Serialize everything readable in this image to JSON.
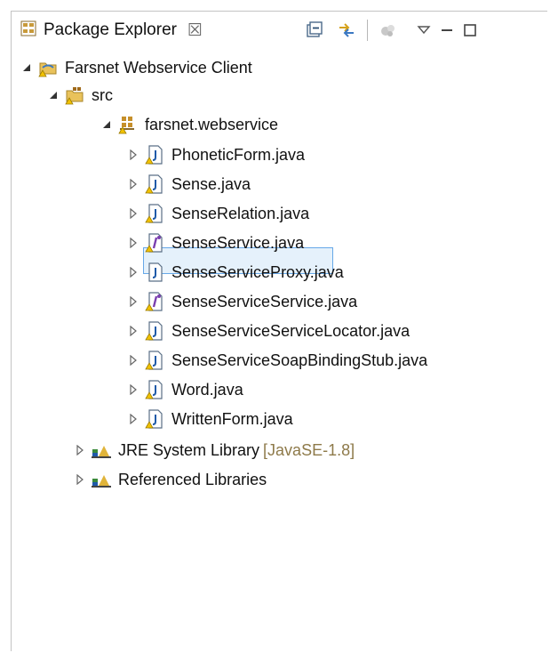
{
  "panel": {
    "title": "Package Explorer",
    "close_glyph": "☒",
    "title_icon": "package-explorer-icon",
    "tools": [
      "collapse-all-icon",
      "link-with-editor-icon",
      "focus-on-active-task-icon",
      "view-menu-icon",
      "minimize-icon",
      "maximize-icon"
    ]
  },
  "tree": {
    "project": {
      "label": "Farsnet Webservice Client",
      "icon": "java-project-warning-icon",
      "expanded": true
    },
    "src_folder": {
      "label": "src",
      "icon": "source-folder-warning-icon",
      "expanded": true
    },
    "package": {
      "label": "farsnet.webservice",
      "icon": "package-warning-icon",
      "expanded": true
    },
    "files": [
      {
        "label": "PhoneticForm.java",
        "icon": "java-class-warning-icon",
        "selected": false
      },
      {
        "label": "Sense.java",
        "icon": "java-class-warning-icon",
        "selected": false
      },
      {
        "label": "SenseRelation.java",
        "icon": "java-class-warning-icon",
        "selected": false
      },
      {
        "label": "SenseService.java",
        "icon": "java-interface-warning-icon",
        "selected": true
      },
      {
        "label": "SenseServiceProxy.java",
        "icon": "java-class-icon",
        "selected": false
      },
      {
        "label": "SenseServiceService.java",
        "icon": "java-interface-warning-icon",
        "selected": false
      },
      {
        "label": "SenseServiceServiceLocator.java",
        "icon": "java-class-warning-icon",
        "selected": false
      },
      {
        "label": "SenseServiceSoapBindingStub.java",
        "icon": "java-class-warning-icon",
        "selected": false
      },
      {
        "label": "Word.java",
        "icon": "java-class-warning-icon",
        "selected": false
      },
      {
        "label": "WrittenForm.java",
        "icon": "java-class-warning-icon",
        "selected": false
      }
    ],
    "libraries": [
      {
        "label": "JRE System Library",
        "decoration": "[JavaSE-1.8]",
        "icon": "library-icon"
      },
      {
        "label": "Referenced Libraries",
        "decoration": "",
        "icon": "library-icon"
      }
    ]
  },
  "colors": {
    "selection_border": "#67a8e8",
    "selection_fill": "#e5f1fb",
    "decoration_text": "#8e7a4a",
    "warning": "#f2c200"
  }
}
